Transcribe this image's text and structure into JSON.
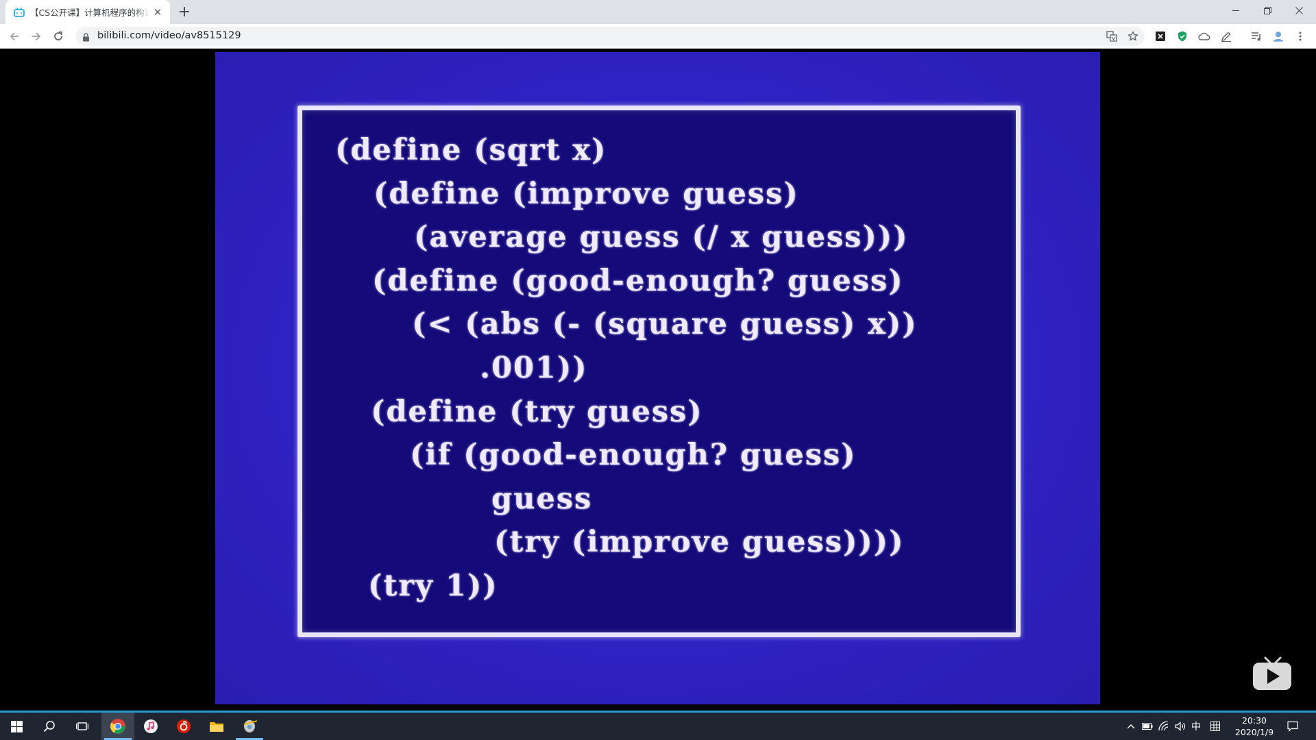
{
  "browser": {
    "tab_title": "【CS公开课】计算机程序的构造和解释",
    "new_tab_label": "+",
    "close_tab_label": "✕",
    "url": "bilibili.com/video/av8515129"
  },
  "video": {
    "code_lines": [
      "(define (sqrt x)",
      "(define (improve guess)",
      "(average guess (/ x guess)))",
      "(define (good-enough? guess)",
      "(< (abs (- (square guess) x))",
      ".001))",
      "(define (try guess)",
      "(if (good-enough? guess)",
      "guess",
      "(try (improve guess))))",
      "(try 1))"
    ],
    "colors": {
      "frame_background": "#2f22c4",
      "slide_background": "#140a7a",
      "code_text": "#efeaff"
    }
  },
  "taskbar": {
    "input_method": "中",
    "time": "20:30",
    "date": "2020/1/9"
  }
}
